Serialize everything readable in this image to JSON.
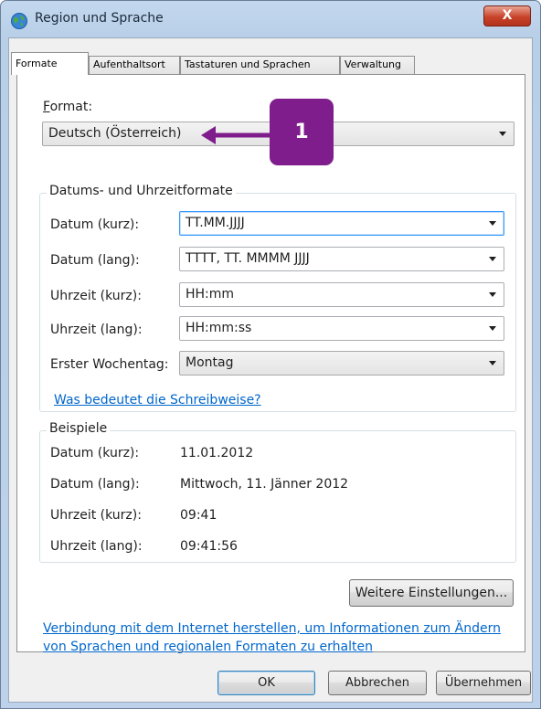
{
  "window": {
    "title": "Region und Sprache",
    "close_label": "X"
  },
  "tabs": [
    {
      "label": "Formate",
      "active": true
    },
    {
      "label": "Aufenthaltsort",
      "active": false
    },
    {
      "label": "Tastaturen und Sprachen",
      "active": false
    },
    {
      "label": "Verwaltung",
      "active": false
    }
  ],
  "format": {
    "label": "Format:",
    "value": "Deutsch (Österreich)"
  },
  "datetime_group": {
    "title": "Datums- und Uhrzeitformate",
    "rows": [
      {
        "label": "Datum (kurz):",
        "value": "TT.MM.JJJJ"
      },
      {
        "label": "Datum (lang):",
        "value": "TTTT, TT. MMMM JJJJ"
      },
      {
        "label": "Uhrzeit (kurz):",
        "value": "HH:mm"
      },
      {
        "label": "Uhrzeit (lang):",
        "value": "HH:mm:ss"
      },
      {
        "label": "Erster Wochentag:",
        "value": "Montag"
      }
    ],
    "notation_link": "Was bedeutet die Schreibweise?"
  },
  "examples": {
    "title": "Beispiele",
    "rows": [
      {
        "label": "Datum (kurz):",
        "value": "11.01.2012"
      },
      {
        "label": "Datum (lang):",
        "value": "Mittwoch, 11. Jänner 2012"
      },
      {
        "label": "Uhrzeit (kurz):",
        "value": "09:41"
      },
      {
        "label": "Uhrzeit (lang):",
        "value": "09:41:56"
      }
    ]
  },
  "more_settings_button": "Weitere Einstellungen...",
  "internet_link": {
    "line1": "Verbindung mit dem Internet herstellen, um Informationen zum Ändern",
    "line2": "von Sprachen und regionalen Formaten zu erhalten"
  },
  "footer": {
    "ok": "OK",
    "cancel": "Abbrechen",
    "apply": "Übernehmen"
  },
  "annotation": {
    "badge": "1",
    "color": "#7f1d8c"
  },
  "colors": {
    "link": "#0066cc",
    "focus_border": "#3399ff",
    "close_button": "#c8432a"
  }
}
